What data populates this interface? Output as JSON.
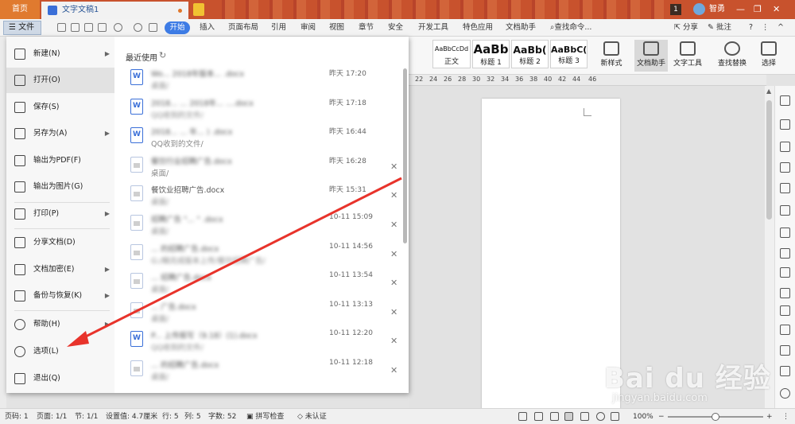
{
  "titlebar": {
    "home_tab": "首页",
    "doc_tab": "文字文稿1",
    "notification_count": "1",
    "user_name": "智勇",
    "window_controls": [
      "—",
      "❐",
      "✕"
    ]
  },
  "ribbon": {
    "file_label": "文件",
    "active_tab": "开始",
    "tabs": [
      "插入",
      "页面布局",
      "引用",
      "审阅",
      "视图",
      "章节",
      "安全",
      "开发工具",
      "特色应用",
      "文档助手"
    ],
    "search_placeholder": "查找命令...",
    "share_label": "分享",
    "comment_label": "批注",
    "help_label": "?"
  },
  "toolbar": {
    "styles": [
      {
        "sample": "AaBbCcDd",
        "label": "正文"
      },
      {
        "sample": "AaBb",
        "label": "标题 1"
      },
      {
        "sample": "AaBb(",
        "label": "标题 2"
      },
      {
        "sample": "AaBbC(",
        "label": "标题 3"
      }
    ],
    "tools": [
      {
        "label": "新样式"
      },
      {
        "label": "文档助手"
      },
      {
        "label": "文字工具"
      },
      {
        "label": "查找替换"
      },
      {
        "label": "选择"
      }
    ]
  },
  "ruler": {
    "ticks": [
      "22",
      "24",
      "26",
      "28",
      "30",
      "32",
      "34",
      "36",
      "38",
      "40",
      "42",
      "44",
      "46"
    ]
  },
  "file_menu": {
    "items": [
      {
        "label": "新建(N)",
        "has_submenu": true
      },
      {
        "label": "打开(O)",
        "has_submenu": false
      },
      {
        "label": "保存(S)",
        "has_submenu": false
      },
      {
        "label": "另存为(A)",
        "has_submenu": true
      },
      {
        "label": "输出为PDF(F)",
        "has_submenu": false
      },
      {
        "label": "输出为图片(G)",
        "has_submenu": false
      },
      {
        "label": "打印(P)",
        "has_submenu": true
      },
      {
        "label": "分享文档(D)",
        "has_submenu": false
      },
      {
        "label": "文档加密(E)",
        "has_submenu": true
      },
      {
        "label": "备份与恢复(K)",
        "has_submenu": true
      },
      {
        "label": "帮助(H)",
        "has_submenu": true
      },
      {
        "label": "选项(L)",
        "has_submenu": false
      },
      {
        "label": "退出(Q)",
        "has_submenu": false
      }
    ],
    "recent_title": "最近使用",
    "recent": [
      {
        "name": "Wo... 2018年版本... .docx",
        "path": "桌面/",
        "time": "昨天 17:20",
        "type": "word",
        "closable": false
      },
      {
        "name": "2018... ... 2018年... ....docx",
        "path": "QQ收到的文件/",
        "time": "昨天 17:18",
        "type": "word",
        "closable": false
      },
      {
        "name": "2018... ... 年... ) .docx",
        "path": "QQ收到的文件/",
        "time": "昨天 16:44",
        "type": "word",
        "closable": false
      },
      {
        "name": "餐饮行业招聘广告.docx",
        "path": "桌面/",
        "time": "昨天 16:28",
        "type": "grey",
        "closable": true
      },
      {
        "name": "餐饮业招聘广告.docx",
        "path": "桌面/",
        "time": "昨天 15:31",
        "type": "grey",
        "closable": true
      },
      {
        "name": "招聘广告 \"... \" .docx",
        "path": "桌面/",
        "time": "10-11 15:09",
        "type": "grey",
        "closable": true
      },
      {
        "name": "... 的招聘广告.docx",
        "path": "G:/稿完成版本上传/餐饮招聘广告/",
        "time": "10-11 14:56",
        "type": "grey",
        "closable": true
      },
      {
        "name": "... 招聘广告.docx",
        "path": "桌面/",
        "time": "10-11 13:54",
        "type": "grey",
        "closable": true
      },
      {
        "name": "... 广告.docx",
        "path": "桌面/",
        "time": "10-11 13:13",
        "type": "grey",
        "closable": true
      },
      {
        "name": "P... 上传报写（9.18）(1).docx",
        "path": "QQ收到的文件/",
        "time": "10-11 12:20",
        "type": "word",
        "closable": true
      },
      {
        "name": "... 的招聘广告.docx",
        "path": "桌面/",
        "time": "10-11 12:18",
        "type": "grey",
        "closable": true
      }
    ]
  },
  "statusbar": {
    "page_num": "页码: 1",
    "page_of": "页面: 1/1",
    "section": "节: 1/1",
    "setting": "设置值: 4.7厘米",
    "row": "行: 5",
    "col": "列: 5",
    "word_count": "字数: 52",
    "spell_check": "拼写检查",
    "auth": "未认证",
    "zoom": "100%",
    "zoom_minus": "−",
    "zoom_plus": "+",
    "zoom_level": 0.5
  },
  "watermark": {
    "brand": "Bai du 经验",
    "url": "jingyan.baidu.com"
  },
  "colors": {
    "accent": "#3e7ce5",
    "titlebar": "#c8522d",
    "arrow": "#e8332b"
  }
}
